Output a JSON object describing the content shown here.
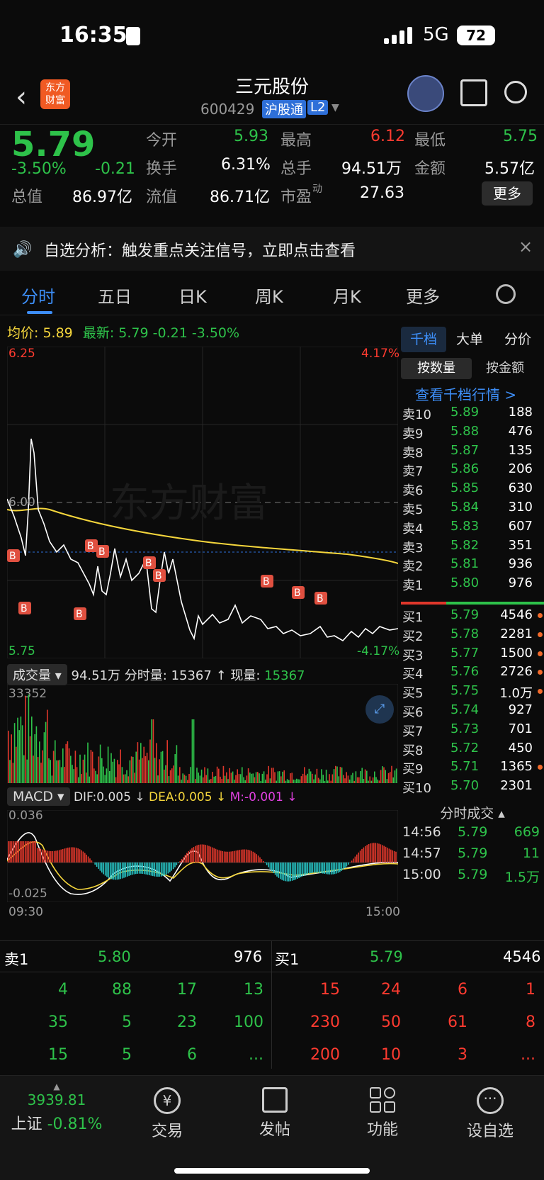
{
  "status": {
    "time": "16:35",
    "network": "5G",
    "battery": "72"
  },
  "nav": {
    "title": "三元股份",
    "code": "600429",
    "badge_hgt": "沪股通",
    "badge_l2": "L2"
  },
  "quote": {
    "price": "5.79",
    "pct": "-3.50%",
    "chg": "-0.21",
    "open_label": "今开",
    "open": "5.93",
    "high_label": "最高",
    "high": "6.12",
    "low_label": "最低",
    "low": "5.75",
    "turnover_label": "换手",
    "turnover": "6.31%",
    "volume_label": "总手",
    "volume": "94.51万",
    "amount_label": "金额",
    "amount": "5.57亿",
    "mktcap_label": "总值",
    "mktcap": "86.97亿",
    "float_label": "流值",
    "float": "86.71亿",
    "pe_label": "市盈",
    "pe_sup": "动",
    "pe": "27.63",
    "more_button": "更多"
  },
  "notice": {
    "text": "自选分析：触发重点关注信号，立即点击查看"
  },
  "tabs": [
    "分时",
    "五日",
    "日K",
    "周K",
    "月K",
    "更多"
  ],
  "intraday": {
    "avg_label": "均价:",
    "avg": "5.89",
    "latest_label": "最新:",
    "latest": "5.79",
    "latest_chg": "-0.21",
    "latest_pct": "-3.50%",
    "price_top": "6.25",
    "pct_top": "4.17%",
    "price_mid": "6.00",
    "price_bottom": "5.75",
    "pct_bottom": "-4.17%",
    "watermark": "东方财富",
    "marker": "B"
  },
  "volume_panel": {
    "dropdown": "成交量",
    "total": "94.51万",
    "tick_label": "分时量:",
    "tick": "15367",
    "now_label": "现量:",
    "now": "15367",
    "max": "33352"
  },
  "macd_panel": {
    "dropdown": "MACD",
    "dif": "DIF:0.005",
    "dea": "DEA:0.005",
    "m": "M:-0.001",
    "top": "0.036",
    "bottom": "-0.025",
    "time_start": "09:30",
    "time_end": "15:00"
  },
  "orderbook": {
    "tabs": [
      "千档",
      "大单",
      "分价"
    ],
    "subtabs": [
      "按数量",
      "按金额"
    ],
    "link": "查看千档行情 >",
    "asks": [
      {
        "label": "卖10",
        "price": "5.89",
        "vol": "188"
      },
      {
        "label": "卖9",
        "price": "5.88",
        "vol": "476"
      },
      {
        "label": "卖8",
        "price": "5.87",
        "vol": "135"
      },
      {
        "label": "卖7",
        "price": "5.86",
        "vol": "206"
      },
      {
        "label": "卖6",
        "price": "5.85",
        "vol": "630"
      },
      {
        "label": "卖5",
        "price": "5.84",
        "vol": "310"
      },
      {
        "label": "卖4",
        "price": "5.83",
        "vol": "607"
      },
      {
        "label": "卖3",
        "price": "5.82",
        "vol": "351"
      },
      {
        "label": "卖2",
        "price": "5.81",
        "vol": "936"
      },
      {
        "label": "卖1",
        "price": "5.80",
        "vol": "976"
      }
    ],
    "bids": [
      {
        "label": "买1",
        "price": "5.79",
        "vol": "4546"
      },
      {
        "label": "买2",
        "price": "5.78",
        "vol": "2281"
      },
      {
        "label": "买3",
        "price": "5.77",
        "vol": "1500"
      },
      {
        "label": "买4",
        "price": "5.76",
        "vol": "2726"
      },
      {
        "label": "买5",
        "price": "5.75",
        "vol": "1.0万"
      },
      {
        "label": "买6",
        "price": "5.74",
        "vol": "927"
      },
      {
        "label": "买7",
        "price": "5.73",
        "vol": "701"
      },
      {
        "label": "买8",
        "price": "5.72",
        "vol": "450"
      },
      {
        "label": "买9",
        "price": "5.71",
        "vol": "1365"
      },
      {
        "label": "买10",
        "price": "5.70",
        "vol": "2301"
      }
    ],
    "trades_title": "分时成交",
    "trades": [
      {
        "time": "14:56",
        "price": "5.79",
        "vol": "669"
      },
      {
        "time": "14:57",
        "price": "5.79",
        "vol": "11"
      },
      {
        "time": "15:00",
        "price": "5.79",
        "vol": "1.5万"
      }
    ]
  },
  "queue": {
    "ask_label": "卖1",
    "ask_price": "5.80",
    "ask_vol": "976",
    "bid_label": "买1",
    "bid_price": "5.79",
    "bid_vol": "4546",
    "ask_rows": [
      [
        "4",
        "88",
        "17",
        "13"
      ],
      [
        "35",
        "5",
        "23",
        "100"
      ],
      [
        "15",
        "5",
        "6",
        "..."
      ]
    ],
    "bid_rows": [
      [
        "15",
        "24",
        "6",
        "1"
      ],
      [
        "230",
        "50",
        "61",
        "8"
      ],
      [
        "200",
        "10",
        "3",
        "..."
      ]
    ]
  },
  "toolbar": {
    "index_value": "3939.81",
    "index_name": "上证",
    "index_pct": "-0.81%",
    "trade": "交易",
    "post": "发帖",
    "function": "功能",
    "watch": "设自选"
  }
}
